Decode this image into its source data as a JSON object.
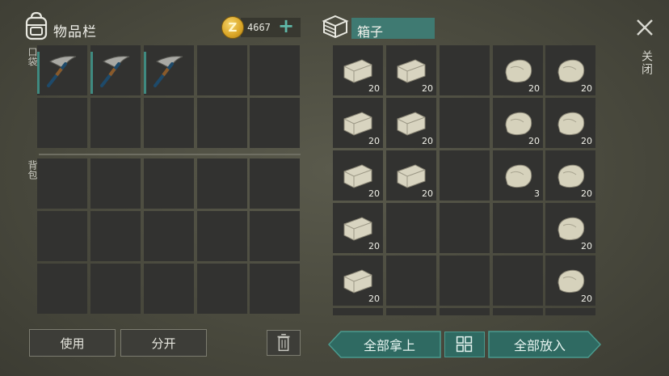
{
  "inventory": {
    "title": "物品栏"
  },
  "currency": {
    "coin_symbol": "Z",
    "amount": "4667",
    "add_symbol": "+"
  },
  "sections": {
    "pocket_label": "口袋",
    "backpack_label": "背包"
  },
  "pocket_items": [
    {
      "icon": "pickaxe-icon"
    },
    {
      "icon": "pickaxe-icon"
    },
    {
      "icon": "pickaxe-icon"
    }
  ],
  "container": {
    "name": "箱子"
  },
  "container_items": [
    {
      "row": 0,
      "col": 0,
      "icon": "stone-brick-icon",
      "qty": "20"
    },
    {
      "row": 0,
      "col": 1,
      "icon": "stone-brick-icon",
      "qty": "20"
    },
    {
      "row": 0,
      "col": 3,
      "icon": "stone-rock-icon",
      "qty": "20"
    },
    {
      "row": 0,
      "col": 4,
      "icon": "stone-rock-icon",
      "qty": "20"
    },
    {
      "row": 1,
      "col": 0,
      "icon": "stone-brick-icon",
      "qty": "20"
    },
    {
      "row": 1,
      "col": 1,
      "icon": "stone-brick-icon",
      "qty": "20"
    },
    {
      "row": 1,
      "col": 3,
      "icon": "stone-rock-icon",
      "qty": "20"
    },
    {
      "row": 1,
      "col": 4,
      "icon": "stone-rock-icon",
      "qty": "20"
    },
    {
      "row": 2,
      "col": 0,
      "icon": "stone-brick-icon",
      "qty": "20"
    },
    {
      "row": 2,
      "col": 1,
      "icon": "stone-brick-icon",
      "qty": "20"
    },
    {
      "row": 2,
      "col": 3,
      "icon": "stone-rock-icon",
      "qty": "3"
    },
    {
      "row": 2,
      "col": 4,
      "icon": "stone-rock-icon",
      "qty": "20"
    },
    {
      "row": 3,
      "col": 0,
      "icon": "stone-brick-icon",
      "qty": "20"
    },
    {
      "row": 3,
      "col": 4,
      "icon": "stone-rock-icon",
      "qty": "20"
    },
    {
      "row": 4,
      "col": 0,
      "icon": "stone-brick-icon",
      "qty": "20"
    },
    {
      "row": 4,
      "col": 4,
      "icon": "stone-rock-icon",
      "qty": "20"
    }
  ],
  "close": {
    "label": "关闭"
  },
  "buttons": {
    "use": "使用",
    "split": "分开",
    "take_all": "全部拿上",
    "put_all": "全部放入"
  },
  "colors": {
    "accent": "#3f7a72",
    "coin": "#d9a526"
  }
}
